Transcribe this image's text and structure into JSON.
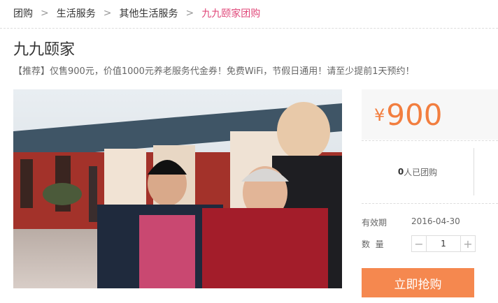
{
  "breadcrumb": {
    "items": [
      "团购",
      "生活服务",
      "其他生活服务",
      "九九颐家团购"
    ],
    "separator": ">"
  },
  "deal": {
    "title": "九九颐家",
    "subtitle": "【推荐】仅售900元，价值1000元养老服务代金券！免费WiFi，节假日通用！请至少提前1天预约！",
    "photo_alt": "photo"
  },
  "price": {
    "currency": "¥",
    "amount": "900"
  },
  "sold": {
    "count": "0",
    "label": "人已团购"
  },
  "validity": {
    "label": "有效期",
    "value": "2016-04-30"
  },
  "quantity": {
    "label": "数  量",
    "value": "1",
    "minus": "−",
    "plus": "+"
  },
  "buy_button": "立即抢购",
  "colors": {
    "accent": "#f27e3f",
    "button": "#f5884f",
    "breadcrumb_current": "#e0487a"
  }
}
